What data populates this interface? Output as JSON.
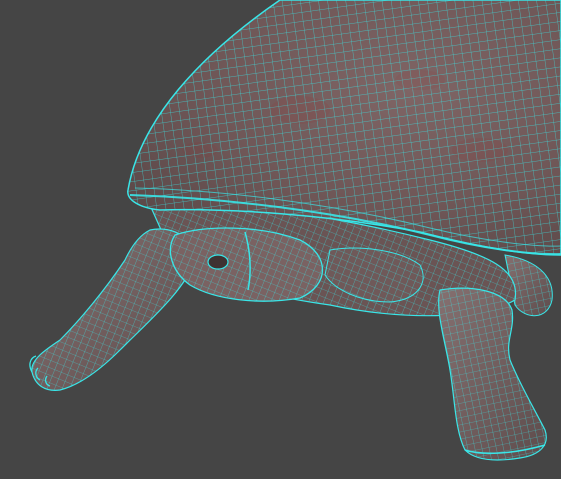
{
  "viewport": {
    "background": "#454545"
  },
  "model": {
    "subject": "turtle",
    "render_mode": "wireframe-on-shaded",
    "wire_color": "#39E6E8",
    "shell_color": "#6E5656",
    "shell_highlight": "#7F6565",
    "skin_color": "#786060",
    "skin_dark": "#4D3E3E",
    "accent_red": "#9A2E2E"
  }
}
